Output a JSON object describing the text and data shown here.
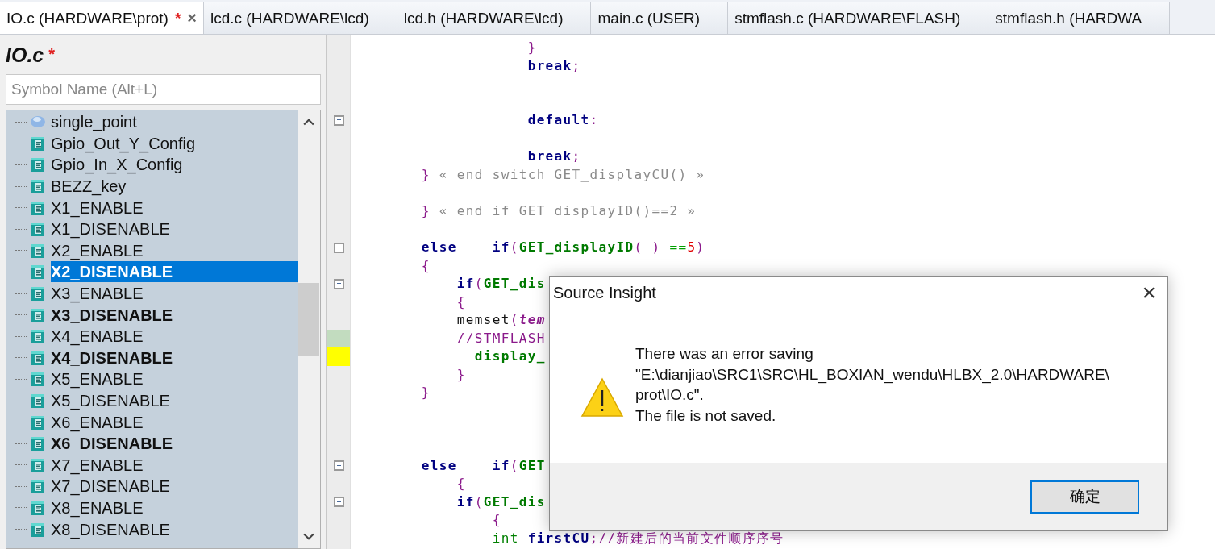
{
  "tabs": [
    {
      "label": "IO.c (HARDWARE\\prot)",
      "modified": "*",
      "selected": true,
      "close": "×"
    },
    {
      "label": "lcd.c (HARDWARE\\lcd)",
      "selected": false
    },
    {
      "label": "lcd.h (HARDWARE\\lcd)",
      "selected": false
    },
    {
      "label": "main.c (USER)",
      "selected": false
    },
    {
      "label": "stmflash.c (HARDWARE\\FLASH)",
      "selected": false
    },
    {
      "label": "stmflash.h (HARDWA",
      "selected": false
    }
  ],
  "symbol_panel": {
    "title": "IO.c",
    "modified": "*",
    "search": {
      "placeholder": "Symbol Name (Alt+L)"
    },
    "items": [
      {
        "label": "single_point",
        "kind": "variable",
        "bold": false,
        "selected": false
      },
      {
        "label": "Gpio_Out_Y_Config",
        "kind": "function",
        "bold": false,
        "selected": false
      },
      {
        "label": "Gpio_In_X_Config",
        "kind": "function",
        "bold": false,
        "selected": false
      },
      {
        "label": "BEZZ_key",
        "kind": "function",
        "bold": false,
        "selected": false
      },
      {
        "label": "X1_ENABLE",
        "kind": "function",
        "bold": false,
        "selected": false
      },
      {
        "label": "X1_DISENABLE",
        "kind": "function",
        "bold": false,
        "selected": false
      },
      {
        "label": "X2_ENABLE",
        "kind": "function",
        "bold": false,
        "selected": false
      },
      {
        "label": "X2_DISENABLE",
        "kind": "function",
        "bold": true,
        "selected": true
      },
      {
        "label": "X3_ENABLE",
        "kind": "function",
        "bold": false,
        "selected": false
      },
      {
        "label": "X3_DISENABLE",
        "kind": "function",
        "bold": true,
        "selected": false
      },
      {
        "label": "X4_ENABLE",
        "kind": "function",
        "bold": false,
        "selected": false
      },
      {
        "label": "X4_DISENABLE",
        "kind": "function",
        "bold": true,
        "selected": false
      },
      {
        "label": "X5_ENABLE",
        "kind": "function",
        "bold": false,
        "selected": false
      },
      {
        "label": "X5_DISENABLE",
        "kind": "function",
        "bold": false,
        "selected": false
      },
      {
        "label": "X6_ENABLE",
        "kind": "function",
        "bold": false,
        "selected": false
      },
      {
        "label": "X6_DISENABLE",
        "kind": "function",
        "bold": true,
        "selected": false
      },
      {
        "label": "X7_ENABLE",
        "kind": "function",
        "bold": false,
        "selected": false
      },
      {
        "label": "X7_DISENABLE",
        "kind": "function",
        "bold": false,
        "selected": false
      },
      {
        "label": "X8_ENABLE",
        "kind": "function",
        "bold": false,
        "selected": false
      },
      {
        "label": "X8_DISENABLE",
        "kind": "function",
        "bold": false,
        "selected": false
      }
    ]
  },
  "code": {
    "lines": [
      {
        "kind": "code",
        "tokens": [
          {
            "t": "                    }",
            "kind": "punct"
          }
        ]
      },
      {
        "kind": "code",
        "tokens": [
          {
            "t": "                    break",
            "kind": "kw"
          },
          {
            "t": ";",
            "kind": "punct"
          }
        ]
      },
      {
        "kind": "blank"
      },
      {
        "kind": "blank"
      },
      {
        "kind": "code",
        "fold": true,
        "tokens": [
          {
            "t": "                    default",
            "kind": "kw"
          },
          {
            "t": ":",
            "kind": "punct"
          }
        ]
      },
      {
        "kind": "blank"
      },
      {
        "kind": "code",
        "tokens": [
          {
            "t": "                    break",
            "kind": "kw"
          },
          {
            "t": ";",
            "kind": "punct"
          }
        ]
      },
      {
        "kind": "code",
        "tokens": [
          {
            "t": "        }",
            "kind": "punct"
          },
          {
            "t": " « end switch GET_displayCU() »",
            "kind": "end"
          }
        ]
      },
      {
        "kind": "blank"
      },
      {
        "kind": "code",
        "tokens": [
          {
            "t": "        }",
            "kind": "punct"
          },
          {
            "t": " « end if GET_displayID()==2 »",
            "kind": "end"
          }
        ]
      },
      {
        "kind": "blank"
      },
      {
        "kind": "code",
        "fold": true,
        "tokens": [
          {
            "t": "        else    if",
            "kind": "kw"
          },
          {
            "t": "(",
            "kind": "punct"
          },
          {
            "t": "GET_displayID",
            "kind": "fn"
          },
          {
            "t": "( ) ",
            "kind": "punct"
          },
          {
            "t": "==",
            "kind": "op"
          },
          {
            "t": "5",
            "kind": "num"
          },
          {
            "t": ")",
            "kind": "punct"
          }
        ]
      },
      {
        "kind": "code",
        "tokens": [
          {
            "t": "        {",
            "kind": "punct"
          }
        ]
      },
      {
        "kind": "code",
        "fold": true,
        "tokens": [
          {
            "t": "            if",
            "kind": "kw"
          },
          {
            "t": "(",
            "kind": "punct"
          },
          {
            "t": "GET_dis",
            "kind": "fn"
          }
        ]
      },
      {
        "kind": "code",
        "tokens": [
          {
            "t": "            {",
            "kind": "punct"
          }
        ]
      },
      {
        "kind": "code",
        "tokens": [
          {
            "t": "            memset",
            "kind": "plain"
          },
          {
            "t": "(",
            "kind": "punct"
          },
          {
            "t": "tem",
            "kind": "var"
          }
        ]
      },
      {
        "kind": "code",
        "changed": true,
        "tokens": [
          {
            "t": "            //STMFLASH",
            "kind": "comment"
          }
        ]
      },
      {
        "kind": "code",
        "current": true,
        "tokens": [
          {
            "t": "              display_",
            "kind": "fn"
          }
        ]
      },
      {
        "kind": "code",
        "tokens": [
          {
            "t": "            }",
            "kind": "punct"
          }
        ]
      },
      {
        "kind": "code",
        "tokens": [
          {
            "t": "        }",
            "kind": "punct"
          }
        ]
      },
      {
        "kind": "blank"
      },
      {
        "kind": "blank"
      },
      {
        "kind": "blank"
      },
      {
        "kind": "code",
        "fold": true,
        "tokens": [
          {
            "t": "        else    if",
            "kind": "kw"
          },
          {
            "t": "(",
            "kind": "punct"
          },
          {
            "t": "GET",
            "kind": "fn"
          }
        ]
      },
      {
        "kind": "code",
        "tokens": [
          {
            "t": "            {",
            "kind": "punct"
          }
        ]
      },
      {
        "kind": "code",
        "fold": true,
        "tokens": [
          {
            "t": "            if",
            "kind": "kw"
          },
          {
            "t": "(",
            "kind": "punct"
          },
          {
            "t": "GET_dis",
            "kind": "fn"
          }
        ]
      },
      {
        "kind": "code",
        "tokens": [
          {
            "t": "                {",
            "kind": "punct"
          }
        ]
      },
      {
        "kind": "code",
        "tokens": [
          {
            "t": "                int ",
            "kind": "type"
          },
          {
            "t": "firstCU",
            "kind": "kw"
          },
          {
            "t": ";",
            "kind": "punct"
          },
          {
            "t": "//新建后的当前文件顺序序号",
            "kind": "comment"
          }
        ]
      }
    ]
  },
  "dialog": {
    "title": "Source Insight",
    "close": "×",
    "kind": "warning",
    "message": "There was an error saving\n\"E:\\dianjiao\\SRC1\\SRC\\HL_BOXIAN_wendu\\HLBX_2.0\\HARDWARE\\\nprot\\IO.c\".\nThe file is not saved.",
    "button": "确定"
  }
}
